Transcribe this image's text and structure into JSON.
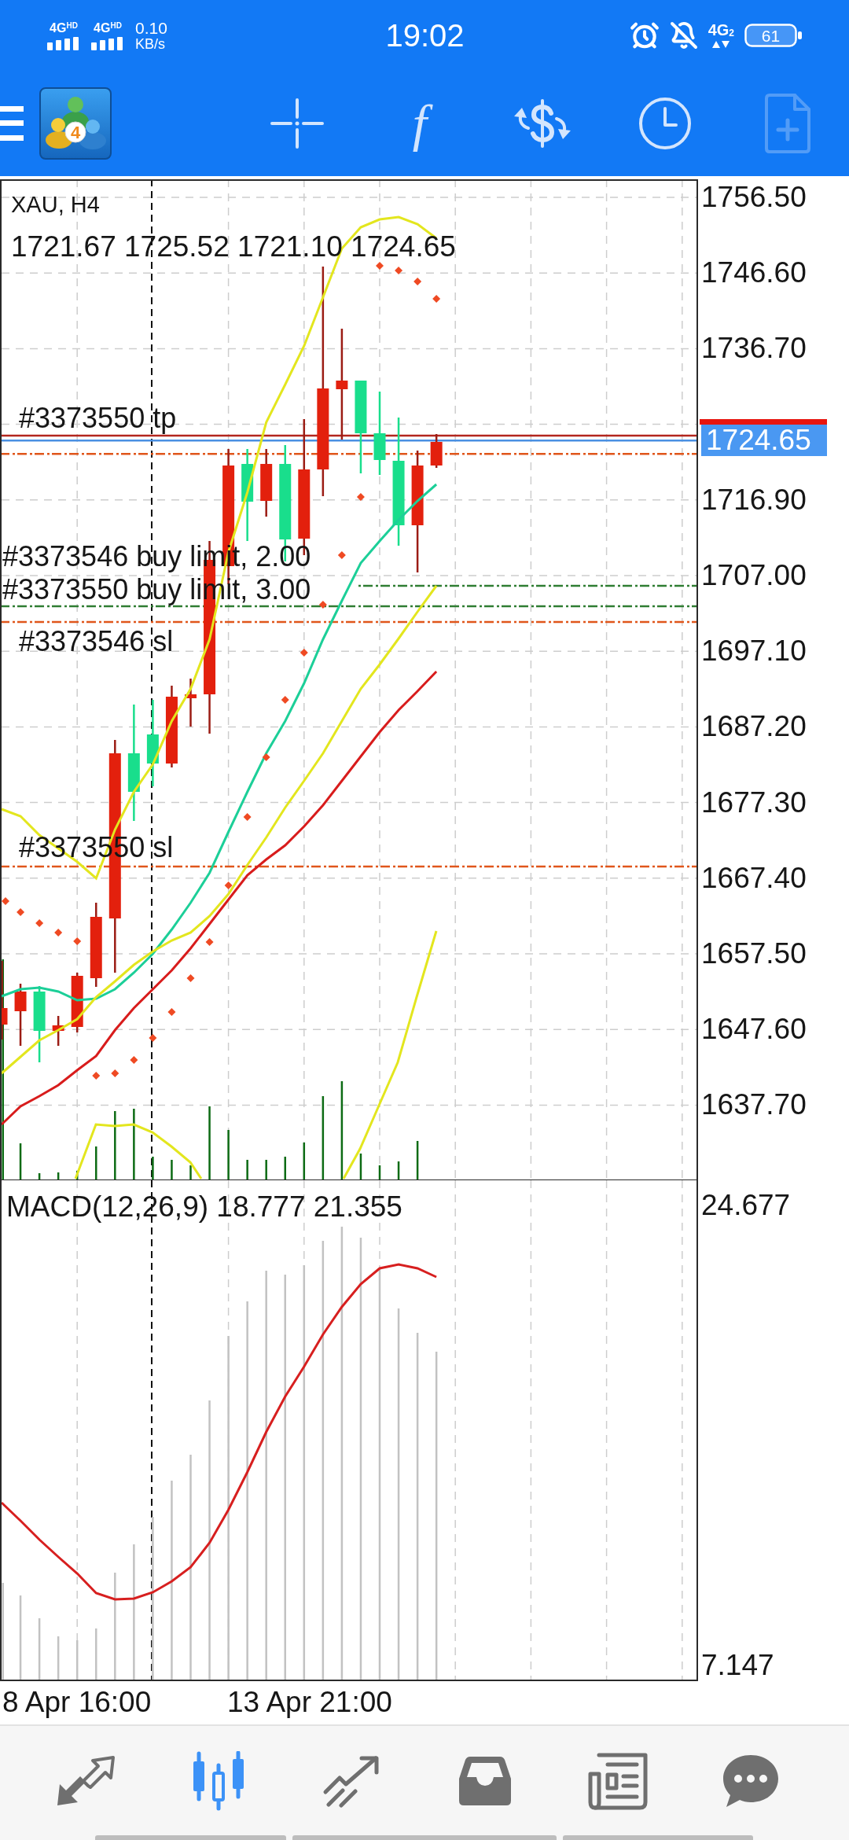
{
  "status_bar": {
    "network": [
      {
        "label": "4G$^{HD}$"
      },
      {
        "label": "4G$^{HD}$"
      }
    ],
    "speed": "0.10",
    "speed_unit": "KB/s",
    "time": "19:02",
    "network_type": "4G$_{2}$",
    "battery": "61"
  },
  "toolbar": {
    "logo_badge": "4",
    "buttons": [
      {
        "kind": "crosshair",
        "disabled": false
      },
      {
        "kind": "indicators",
        "label": "f",
        "disabled": false
      },
      {
        "kind": "trade",
        "disabled": false
      },
      {
        "kind": "period",
        "disabled": false
      },
      {
        "kind": "new_order",
        "disabled": true
      }
    ]
  },
  "chart": {
    "symbol": "XAU, H4",
    "ohlc": "1721.67 1725.52 1721.10 1724.65",
    "order_lines": [
      {
        "label": "#3373550 tp",
        "kind": "tp"
      },
      {
        "label": "#3373546 buy limit, 2.00",
        "kind": "buy_limit"
      },
      {
        "label": "#3373550 buy limit, 3.00",
        "kind": "buy_limit"
      },
      {
        "label": "#3373546 sl",
        "kind": "sl"
      },
      {
        "label": "#3373550 sl",
        "kind": "sl"
      }
    ],
    "price_axis": [
      {
        "kind": "tick",
        "text": "1756.50"
      },
      {
        "kind": "tick",
        "text": "1746.60"
      },
      {
        "kind": "tick",
        "text": "1736.70"
      },
      {
        "kind": "current",
        "text": "1724.65"
      },
      {
        "kind": "tick",
        "text": "1716.90"
      },
      {
        "kind": "tick",
        "text": "1707.00"
      },
      {
        "kind": "tick",
        "text": "1697.10"
      },
      {
        "kind": "tick",
        "text": "1687.20"
      },
      {
        "kind": "tick",
        "text": "1677.30"
      },
      {
        "kind": "tick",
        "text": "1667.40"
      },
      {
        "kind": "tick",
        "text": "1657.50"
      },
      {
        "kind": "tick",
        "text": "1647.60"
      },
      {
        "kind": "tick",
        "text": "1637.70"
      }
    ],
    "time_axis": [
      "8 Apr 16:00",
      "13 Apr 21:00"
    ]
  },
  "macd": {
    "label": "MACD(12,26,9) 18.777 21.355",
    "axis": [
      "24.677",
      "7.147"
    ]
  },
  "bottom_nav": [
    {
      "kind": "quotes",
      "selected": false
    },
    {
      "kind": "chart",
      "selected": true
    },
    {
      "kind": "trade",
      "selected": false
    },
    {
      "kind": "history",
      "selected": false
    },
    {
      "kind": "news",
      "selected": false
    },
    {
      "kind": "chats",
      "selected": false
    }
  ]
}
